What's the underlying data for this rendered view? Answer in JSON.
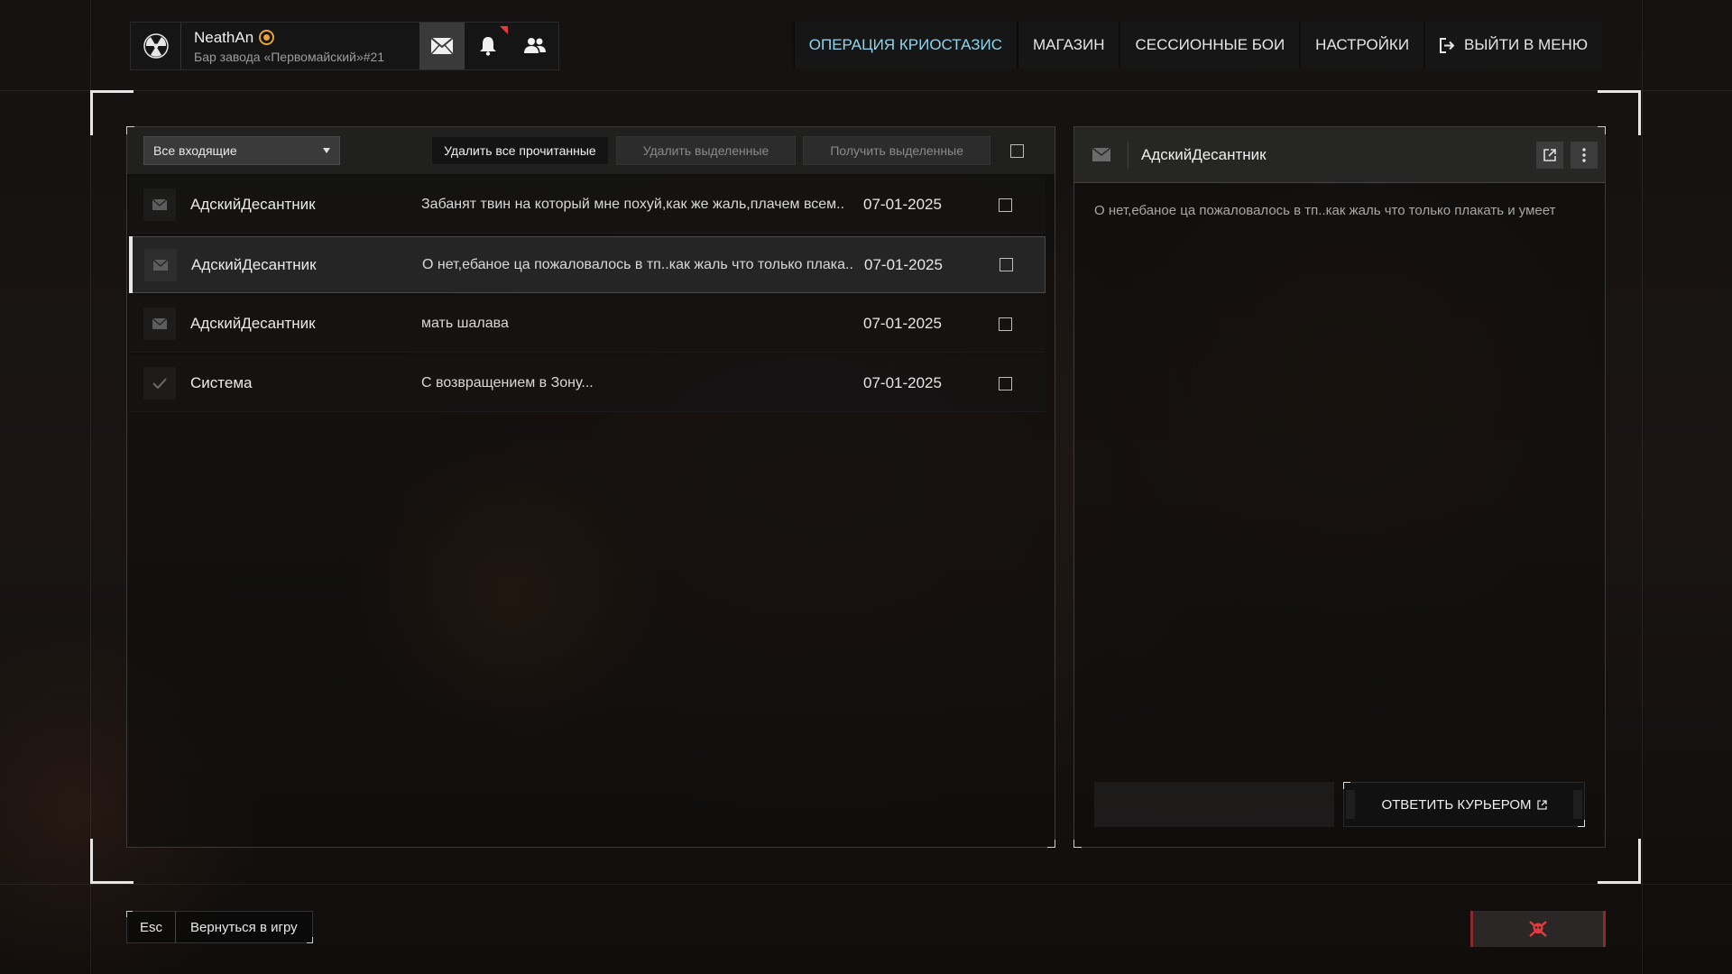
{
  "user": {
    "name": "NeathAn",
    "location": "Бар завода «Первомайский»#21"
  },
  "nav": {
    "items": [
      {
        "label": "ОПЕРАЦИЯ КРИОСТАЗИС"
      },
      {
        "label": "МАГАЗИН"
      },
      {
        "label": "СЕССИОННЫЕ БОИ"
      },
      {
        "label": "НАСТРОЙКИ"
      },
      {
        "label": "ВЫЙТИ В МЕНЮ"
      }
    ],
    "accent_color": "#8fd3ec"
  },
  "mail": {
    "filter": "Все входящие",
    "toolbar": {
      "delete_read": "Удалить все прочитанные",
      "delete_selected": "Удалить выделенные",
      "receive_selected": "Получить выделенные"
    },
    "messages": [
      {
        "sender": "АдскийДесантник",
        "subject": "Забанят твин на который мне похуй,как же жаль,плачем всем..",
        "date": "07-01-2025",
        "icon": "envelope-icon",
        "selected": false
      },
      {
        "sender": "АдскийДесантник",
        "subject": "О нет,ебаное ца пожаловалось в тп..как жаль что только плака..",
        "date": "07-01-2025",
        "icon": "envelope-icon",
        "selected": true
      },
      {
        "sender": "АдскийДесантник",
        "subject": "мать шалава",
        "date": "07-01-2025",
        "icon": "envelope-icon",
        "selected": false
      },
      {
        "sender": "Система",
        "subject": "С возвращением в Зону...",
        "date": "07-01-2025",
        "icon": "checkmark-icon",
        "selected": false
      }
    ]
  },
  "reader": {
    "sender": "АдскийДесантник",
    "body": "О нет,ебаное ца пожаловалось в тп..как жаль что только плакать и умеет",
    "reply_label": "ОТВЕТИТЬ КУРЬЕРОМ"
  },
  "footer": {
    "esc_key": "Esc",
    "esc_label": "Вернуться в игру",
    "danger_color": "#e03c3c"
  }
}
